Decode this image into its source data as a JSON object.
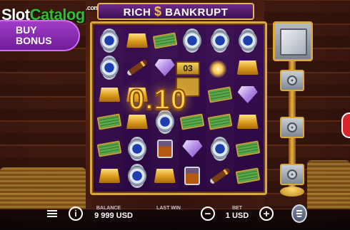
{
  "watermark": {
    "slot": "Slot",
    "catalog": "Catalog",
    "com": ".com"
  },
  "game": {
    "title_left": "RICH",
    "title_symbol": "$",
    "title_right": "BANKRUPT"
  },
  "buy_bonus": {
    "line1": "BUY",
    "line2": "BONUS"
  },
  "reels": {
    "grid": [
      [
        "watch",
        "gold",
        "cash",
        "watch",
        "watch",
        "watch"
      ],
      [
        "watch",
        "cigar",
        "diamond",
        "counter",
        "spark",
        "gold"
      ],
      [
        "gold",
        "gold",
        "win",
        "win",
        "cash",
        "diamond"
      ],
      [
        "cash",
        "gold",
        "watch",
        "cash",
        "cash",
        "gold"
      ],
      [
        "cash",
        "watch",
        "whiskey",
        "diamond",
        "watch",
        "cash"
      ],
      [
        "gold",
        "watch",
        "gold",
        "whiskey",
        "cigar",
        "cash"
      ]
    ],
    "counter_value": "03",
    "win_amount": "0.10"
  },
  "panel": {
    "balance_label": "BALANCE",
    "balance_value": "9 999 USD",
    "last_win_label": "LAST WIN",
    "last_win_value": "",
    "bet_label": "BET",
    "bet_value": "1 USD",
    "minus": "−",
    "plus": "+",
    "info": "i"
  },
  "icons": {
    "menu": "hamburger-menu-icon",
    "info": "info-icon",
    "minus": "minus-icon",
    "plus": "plus-icon",
    "stack": "coin-stack-icon",
    "safe": "safe-icon",
    "lock": "combination-lock-icon"
  },
  "colors": {
    "frame_gold": "#d9a93b",
    "bonus_purple": "#a23dc9",
    "win_gold": "#ffd34f"
  }
}
